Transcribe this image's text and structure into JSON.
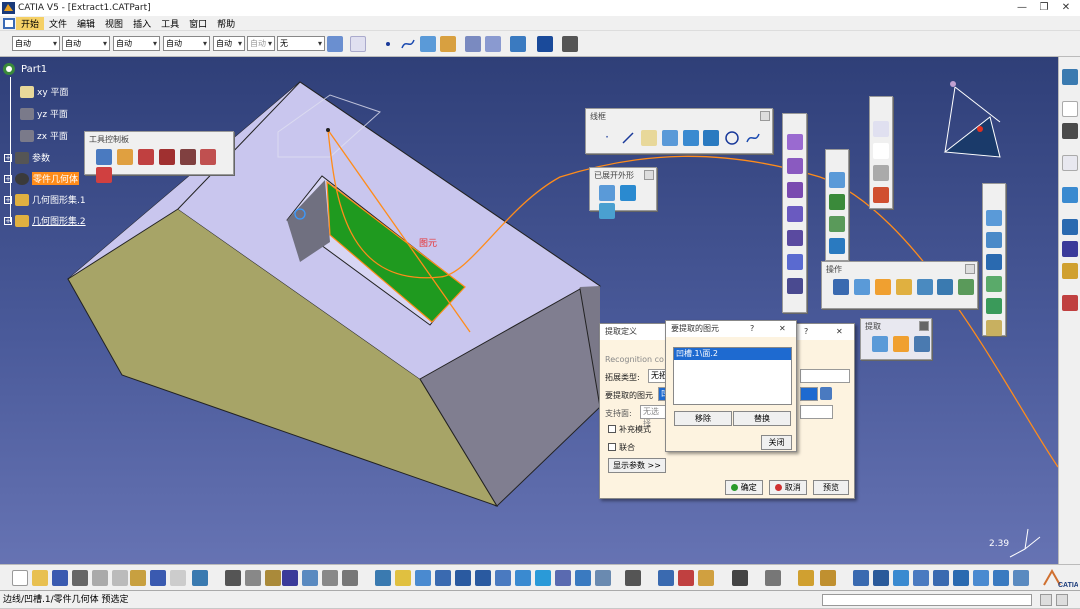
{
  "window": {
    "title": "CATIA V5 - [Extract1.CATPart]",
    "min": "—",
    "max": "❐",
    "close": "✕"
  },
  "menu": [
    "开始",
    "文件",
    "编辑",
    "视图",
    "插入",
    "工具",
    "窗口",
    "帮助"
  ],
  "toolbar": {
    "combos": [
      "自动",
      "自动",
      "自动",
      "自动",
      "自动",
      "自动",
      "无"
    ]
  },
  "tree": {
    "root": "Part1",
    "items": [
      {
        "label": "xy 平面"
      },
      {
        "label": "yz 平面"
      },
      {
        "label": "zx 平面"
      },
      {
        "label": "参数"
      },
      {
        "label": "零件几何体"
      },
      {
        "label": "几何图形集.1"
      },
      {
        "label": "几何图形集.2"
      }
    ]
  },
  "viewport": {
    "element_label": "图元",
    "scale": "2.39"
  },
  "panels": {
    "tool_control": "工具控制板",
    "wireframe": "线框",
    "unfolded": "已展开外形",
    "operations": "操作",
    "extract": "提取"
  },
  "extract_dialog": {
    "title": "提取定义",
    "help": "?",
    "close": "✕",
    "recognition": "Recognition co",
    "propagation_label": "拓展类型:",
    "propagation_value": "无拓",
    "element_label": "要提取的图元",
    "element_value": "凹",
    "support_label": "支持面:",
    "support_value": "无选择",
    "complementary": "补充模式",
    "federation": "联合",
    "show_params": "显示参数 >>",
    "ok": "确定",
    "cancel": "取消",
    "preview": "预览"
  },
  "element_list_dialog": {
    "title": "要提取的图元",
    "help": "?",
    "close": "✕",
    "items": [
      "凹槽.1\\面.2"
    ],
    "remove": "移除",
    "replace": "替换",
    "close_btn": "关闭"
  },
  "status": {
    "text": "边线/凹槽.1/零件几何体 预选定"
  },
  "colors": {
    "viewport_top": "#2f3f78",
    "selection": "#ff8c1a",
    "green_face": "#1f9a1f"
  }
}
